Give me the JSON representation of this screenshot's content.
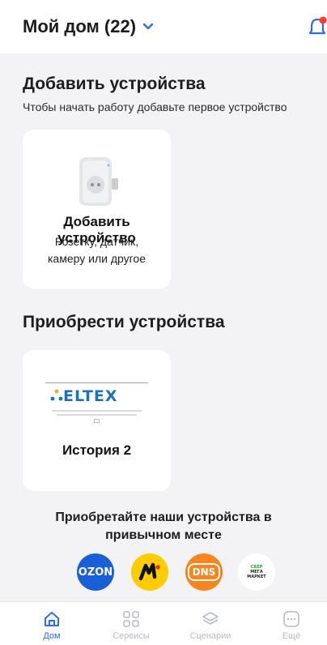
{
  "header": {
    "title": "Мой дом (22)"
  },
  "add_section": {
    "title": "Добавить устройства",
    "subtitle": "Чтобы начать работу добавьте первое устройство",
    "card_title": "Добавить устройство",
    "card_desc_line1": "Розетку, датчик,",
    "card_desc_line2": "камеру или другое"
  },
  "buy_section": {
    "title": "Приобрести устройства",
    "story_brand": "ELTEX",
    "story_title": "История 2",
    "buy_line1": "Приобретайте наши устройства в",
    "buy_line2": "привычном месте",
    "shops": {
      "ozon": "OZON",
      "dns": "DNS",
      "sber_line1": "СБЕР",
      "sber_line2": "МЕГА",
      "sber_line3": "МАРКЕТ"
    }
  },
  "tabs": [
    {
      "label": "Дом",
      "icon": "home-icon"
    },
    {
      "label": "Сервисы",
      "icon": "grid-icon"
    },
    {
      "label": "Сценарии",
      "icon": "layers-icon"
    },
    {
      "label": "Ещё",
      "icon": "more-icon"
    }
  ],
  "colors": {
    "accent": "#2f6bf0",
    "background": "#f3f3f5",
    "inactive": "#b8bcc4"
  }
}
